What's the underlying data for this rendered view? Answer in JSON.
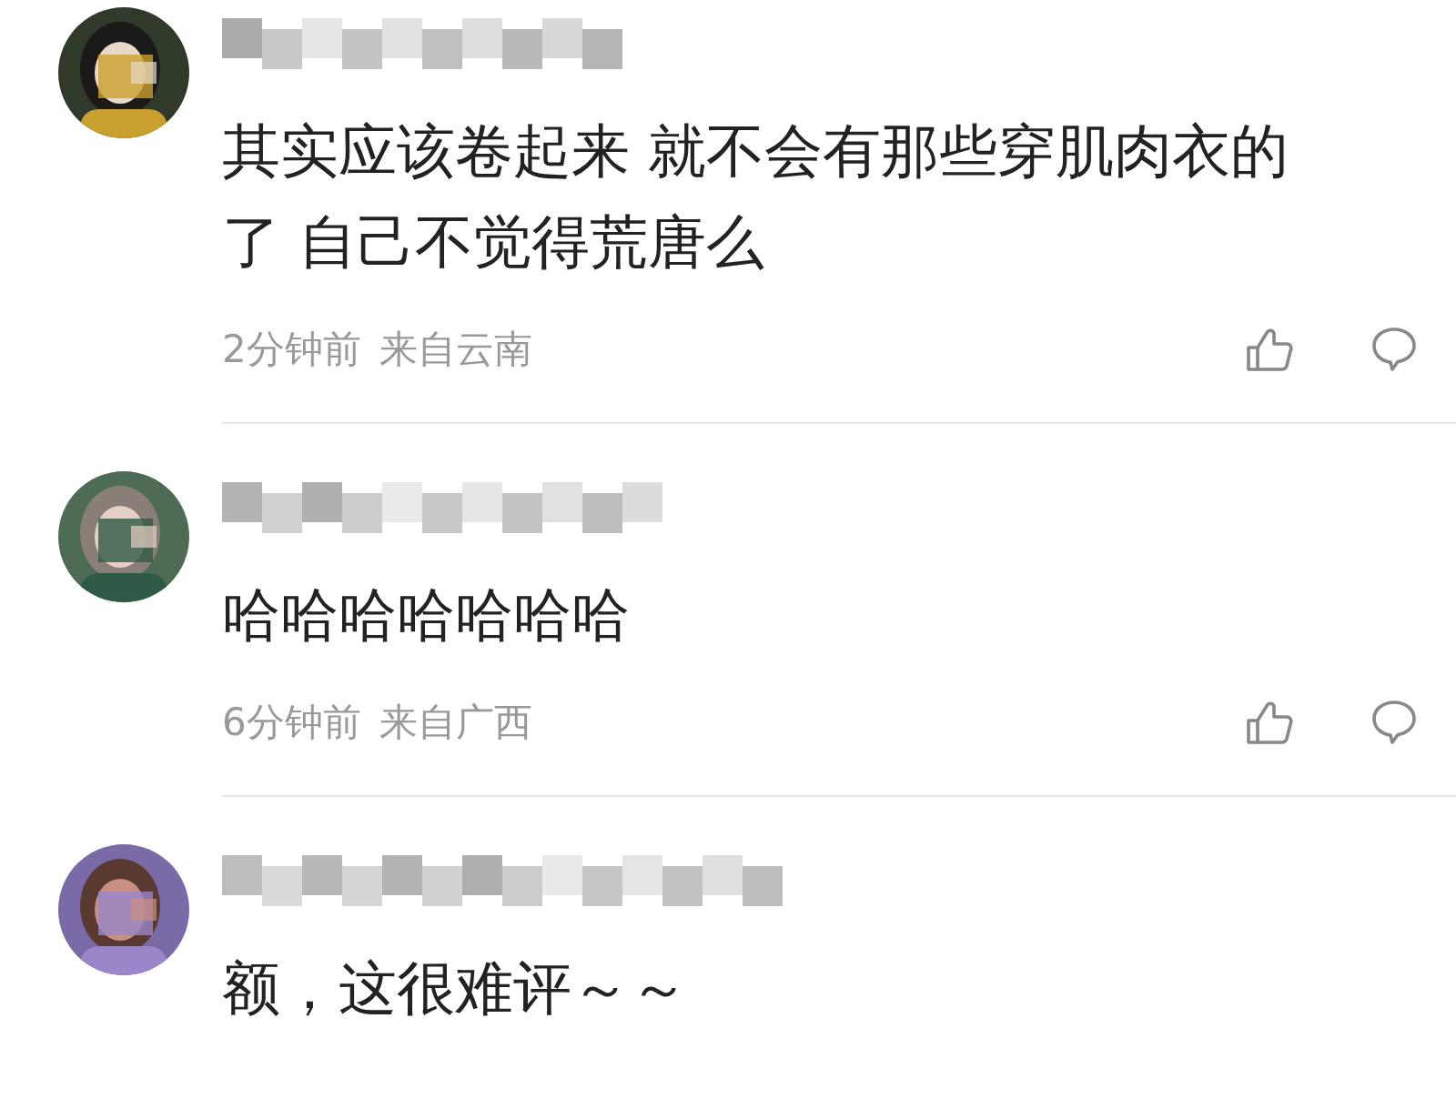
{
  "comments": [
    {
      "avatar": {
        "kind": "picture"
      },
      "username_blurred": true,
      "lines": [
        "其实应该卷起来 就不会有那些穿肌肉衣的",
        "了 自己不觉得荒唐么"
      ],
      "time": "2分钟前",
      "location": "来自云南",
      "actions": true
    },
    {
      "avatar": {
        "kind": "picture"
      },
      "username_blurred": true,
      "lines": [
        "哈哈哈哈哈哈哈"
      ],
      "time": "6分钟前",
      "location": "来自广西",
      "actions": true
    },
    {
      "avatar": {
        "kind": "picture"
      },
      "username_blurred": true,
      "lines": [
        "额，这很难评～～"
      ],
      "actions": false
    }
  ]
}
